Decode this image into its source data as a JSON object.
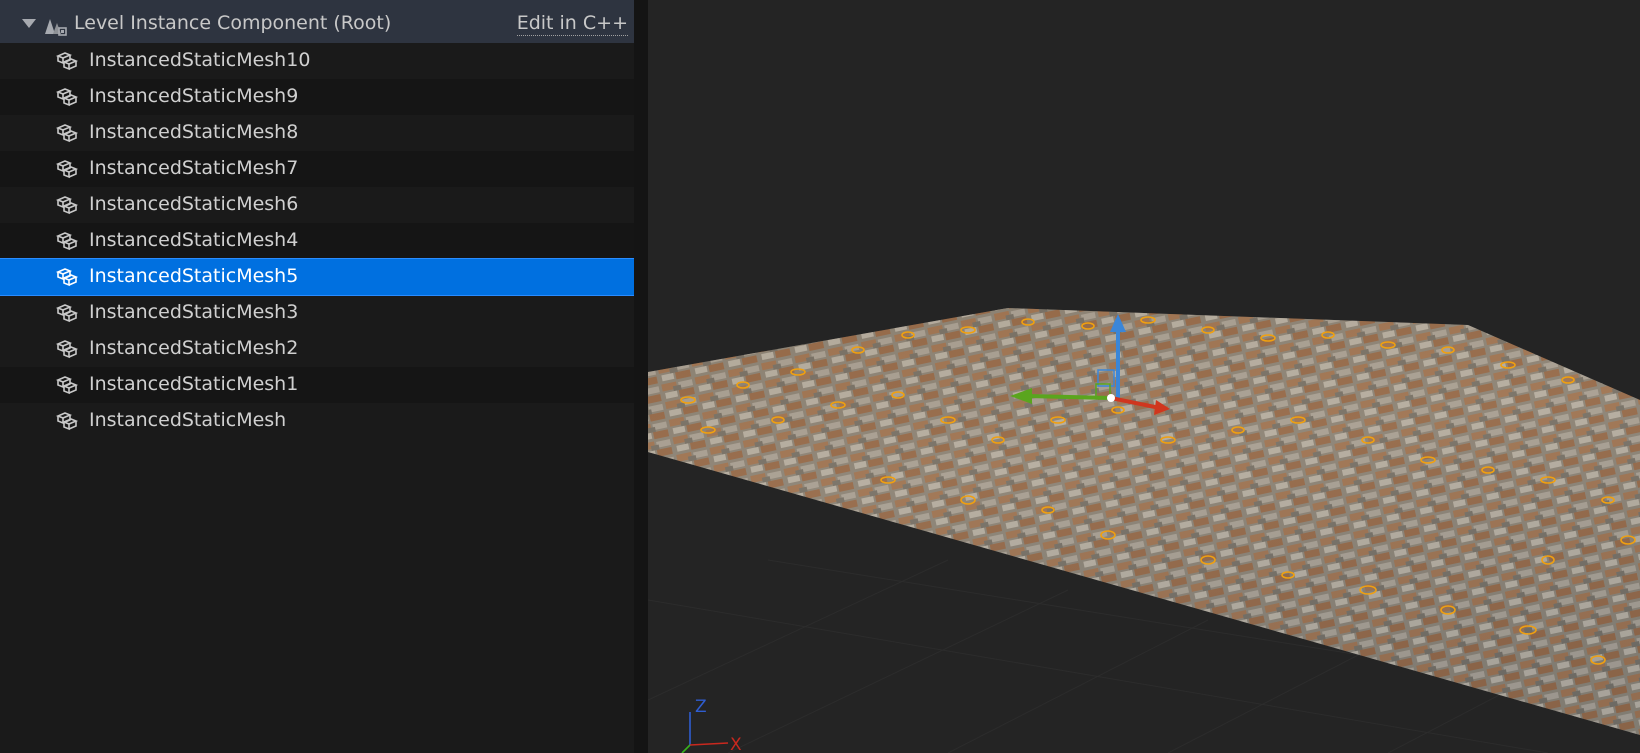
{
  "outliner": {
    "root": {
      "label": "Level Instance Component (Root)",
      "action": "Edit in C++"
    },
    "items": [
      {
        "label": "InstancedStaticMesh10",
        "selected": false
      },
      {
        "label": "InstancedStaticMesh9",
        "selected": false
      },
      {
        "label": "InstancedStaticMesh8",
        "selected": false
      },
      {
        "label": "InstancedStaticMesh7",
        "selected": false
      },
      {
        "label": "InstancedStaticMesh6",
        "selected": false
      },
      {
        "label": "InstancedStaticMesh4",
        "selected": false
      },
      {
        "label": "InstancedStaticMesh5",
        "selected": true
      },
      {
        "label": "InstancedStaticMesh3",
        "selected": false
      },
      {
        "label": "InstancedStaticMesh2",
        "selected": false
      },
      {
        "label": "InstancedStaticMesh1",
        "selected": false
      },
      {
        "label": "InstancedStaticMesh",
        "selected": false
      }
    ]
  },
  "viewport": {
    "axis": {
      "z": "Z",
      "x": "X"
    },
    "gizmo_colors": {
      "x": "#d0361e",
      "y": "#5aa51e",
      "z": "#3a86d8"
    },
    "selection_color": "#f0a010"
  },
  "icons": {
    "root": "level-instance-icon",
    "item": "instanced-static-mesh-icon",
    "expand": "chevron-down-icon"
  }
}
